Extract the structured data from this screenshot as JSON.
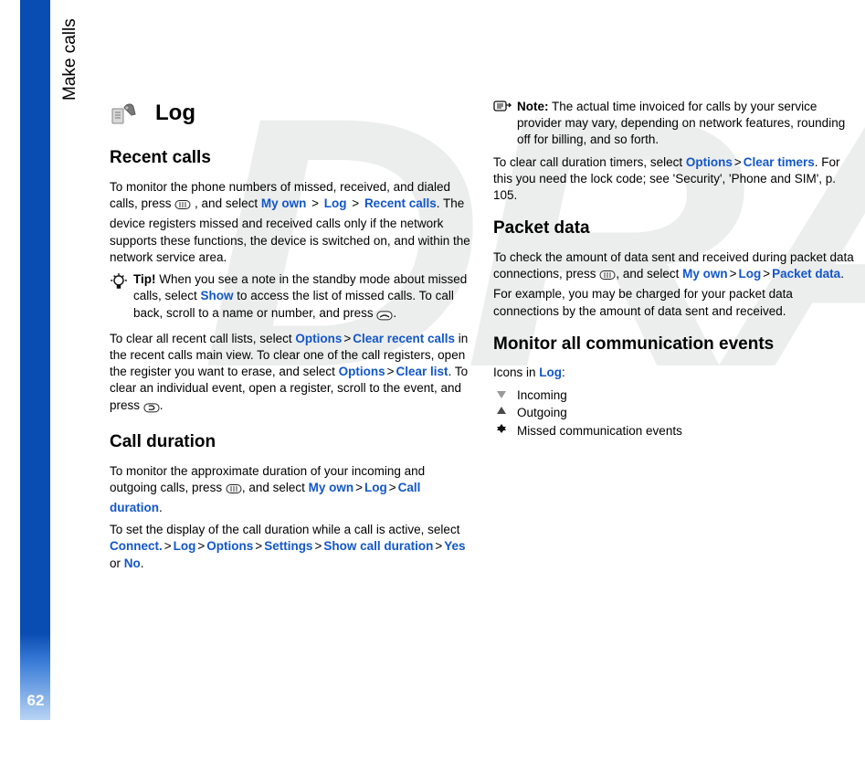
{
  "page": {
    "side_label": "Make calls",
    "number": "62",
    "watermark": "DRAFT"
  },
  "log": {
    "heading": "Log",
    "recent_calls": {
      "heading": "Recent calls",
      "para1_a": "To monitor the phone numbers of missed, received, and dialed calls, press ",
      "para1_b": ", and select ",
      "my_own": "My own",
      "log": "Log",
      "recent_calls_link": "Recent calls",
      "para1_c": ". The device registers missed and received calls only if the network supports these functions, the device is switched on, and within the network service area.",
      "tip_label": "Tip!",
      "tip_a": " When you see a note in the standby mode about missed calls, select ",
      "show": "Show",
      "tip_b": " to access the list of missed calls. To call back, scroll to a name or number, and press ",
      "tip_c": ".",
      "para2_a": "To clear all recent call lists, select ",
      "options": "Options",
      "clear_recent": "Clear recent calls",
      "para2_b": " in the recent calls main view. To clear one of the call registers, open the register you want to erase, and select ",
      "clear_list": "Clear list",
      "para2_c": ". To clear an individual event, open a register, scroll to the event, and press ",
      "para2_d": "."
    },
    "call_duration": {
      "heading": "Call duration",
      "para1_a": "To monitor the approximate duration of your incoming and outgoing calls, press ",
      "para1_b": ", and select ",
      "my_own": "My own",
      "log": "Log",
      "call_duration": "Call duration",
      "para1_c": ".",
      "para2_a": "To set the display of the call duration while a call is active, select ",
      "connect": "Connect.",
      "options": "Options",
      "settings": "Settings",
      "show_call_duration": "Show call duration",
      "yes": "Yes",
      "no": "No",
      "para2_b": " or ",
      "para2_c": ".",
      "note_label": "Note:",
      "note_text": " The actual time invoiced for calls by your service provider may vary, depending on network features, rounding off for billing, and so forth.",
      "para3_a": "To clear call duration timers, select ",
      "clear_timers": "Clear timers",
      "para3_b": ". For this you need the lock code; see 'Security', 'Phone and SIM', p. 105."
    },
    "packet_data": {
      "heading": "Packet data",
      "para1_a": "To check the amount of data sent and received during packet data connections, press ",
      "para1_b": ", and select ",
      "my_own": "My own",
      "log": "Log",
      "packet_data": "Packet data",
      "para1_c": ". For example, you may be charged for your packet data connections by the amount of data sent and received."
    },
    "monitor": {
      "heading": "Monitor all communication events",
      "icons_in": "Icons in ",
      "log": "Log",
      "colon": ":",
      "incoming": "Incoming",
      "outgoing": "Outgoing",
      "missed": "Missed communication events"
    }
  }
}
